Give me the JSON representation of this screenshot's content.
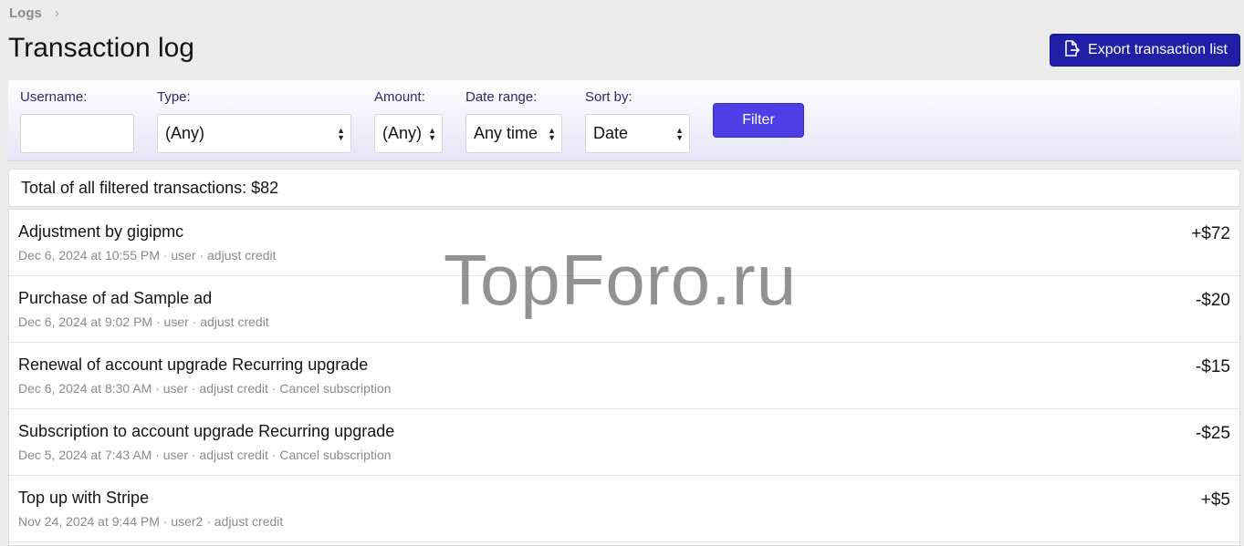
{
  "breadcrumb": {
    "label": "Logs",
    "chevron": "›"
  },
  "page_title": "Transaction log",
  "export_button": {
    "label": "Export transaction list",
    "icon": "file-export-icon"
  },
  "filters": {
    "username": {
      "label": "Username:",
      "value": ""
    },
    "type": {
      "label": "Type:",
      "value": "(Any)"
    },
    "amount": {
      "label": "Amount:",
      "value": "(Any)"
    },
    "date_range": {
      "label": "Date range:",
      "value": "Any time"
    },
    "sort_by": {
      "label": "Sort by:",
      "value": "Date"
    },
    "filter_button": "Filter"
  },
  "total_text": "Total of all filtered transactions: $82",
  "transactions": [
    {
      "description": "Adjustment by gigipmc",
      "meta": "Dec 6, 2024 at 10:55 PM · user · adjust credit",
      "amount": "+$72"
    },
    {
      "description": "Purchase of ad Sample ad",
      "meta": "Dec 6, 2024 at 9:02 PM · user · adjust credit",
      "amount": "-$20"
    },
    {
      "description": "Renewal of account upgrade Recurring upgrade",
      "meta": "Dec 6, 2024 at 8:30 AM · user · adjust credit · Cancel subscription",
      "amount": "-$15"
    },
    {
      "description": "Subscription to account upgrade Recurring upgrade",
      "meta": "Dec 5, 2024 at 7:43 AM · user · adjust credit · Cancel subscription",
      "amount": "-$25"
    },
    {
      "description": "Top up with Stripe",
      "meta": "Nov 24, 2024 at 9:44 PM · user2 · adjust credit",
      "amount": "+$5"
    }
  ],
  "watermark": "TopForo.ru",
  "colors": {
    "primary_dark": "#1f1fa8",
    "primary": "#4d3ee6",
    "background": "#ebebeb"
  }
}
